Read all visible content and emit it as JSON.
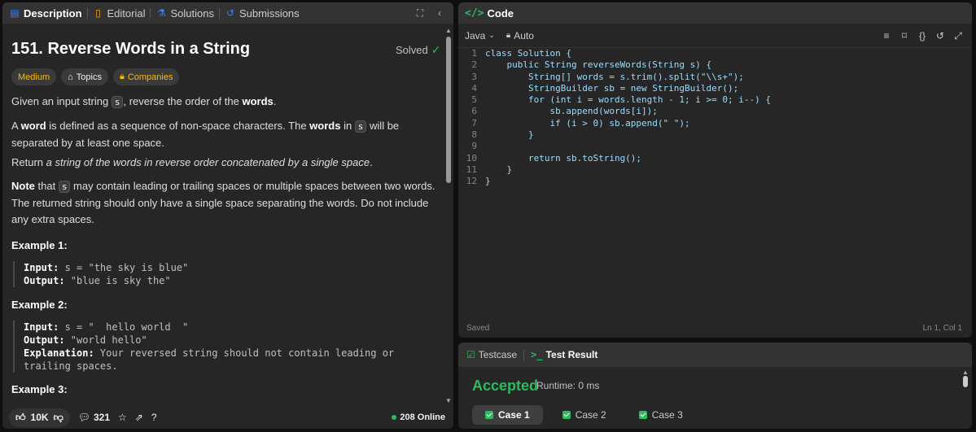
{
  "left_tabs": {
    "description": "Description",
    "editorial": "Editorial",
    "solutions": "Solutions",
    "submissions": "Submissions"
  },
  "problem": {
    "title": "151. Reverse Words in a String",
    "solved_label": "Solved",
    "difficulty": "Medium",
    "topics": "Topics",
    "companies": "Companies",
    "p1_a": "Given an input string ",
    "p1_code": "s",
    "p1_b": ", reverse the order of the ",
    "p1_bold": "words",
    "p1_c": ".",
    "p2_a": "A ",
    "p2_bold1": "word",
    "p2_b": " is defined as a sequence of non-space characters. The ",
    "p2_bold2": "words",
    "p2_c": " in ",
    "p2_code": "s",
    "p2_d": " will be separated by at least one space.",
    "p3_a": "Return ",
    "p3_italic": "a string of the words in reverse order concatenated by a single space",
    "p3_b": ".",
    "p4_bold": "Note",
    "p4_a": " that ",
    "p4_code": "s",
    "p4_b": " may contain leading or trailing spaces or multiple spaces between two words. The returned string should only have a single space separating the words. Do not include any extra spaces."
  },
  "examples": [
    {
      "title": "Example 1:",
      "input_label": "Input:",
      "input": " s = \"the sky is blue\"",
      "output_label": "Output:",
      "output": " \"blue is sky the\""
    },
    {
      "title": "Example 2:",
      "input_label": "Input:",
      "input": " s = \"  hello world  \"",
      "output_label": "Output:",
      "output": " \"world hello\"",
      "explanation_label": "Explanation:",
      "explanation": " Your reversed string should not contain leading or trailing spaces."
    },
    {
      "title": "Example 3:"
    }
  ],
  "footer": {
    "likes": "10K",
    "comments": "321",
    "online": "208 Online"
  },
  "code_panel": {
    "title": "Code",
    "language": "Java",
    "mode": "Auto",
    "status": "Saved",
    "cursor": "Ln 1, Col 1",
    "lines": [
      "class Solution {",
      "    public String reverseWords(String s) {",
      "        String[] words = s.trim().split(\"\\\\s+\");",
      "        StringBuilder sb = new StringBuilder();",
      "        for (int i = words.length - 1; i >= 0; i--) {",
      "            sb.append(words[i]);",
      "            if (i > 0) sb.append(\" \");",
      "        }",
      "",
      "        return sb.toString();",
      "    }",
      "}"
    ],
    "line_numbers": [
      "1",
      "2",
      "3",
      "4",
      "5",
      "6",
      "7",
      "8",
      "9",
      "10",
      "11",
      "12"
    ]
  },
  "result_panel": {
    "testcase_tab": "Testcase",
    "result_tab": "Test Result",
    "verdict": "Accepted",
    "runtime": "Runtime: 0 ms",
    "cases": [
      "Case 1",
      "Case 2",
      "Case 3"
    ]
  },
  "colors": {
    "accent_green": "#2cbb5d",
    "medium_yellow": "#ffb800",
    "panel_bg": "#262626"
  }
}
